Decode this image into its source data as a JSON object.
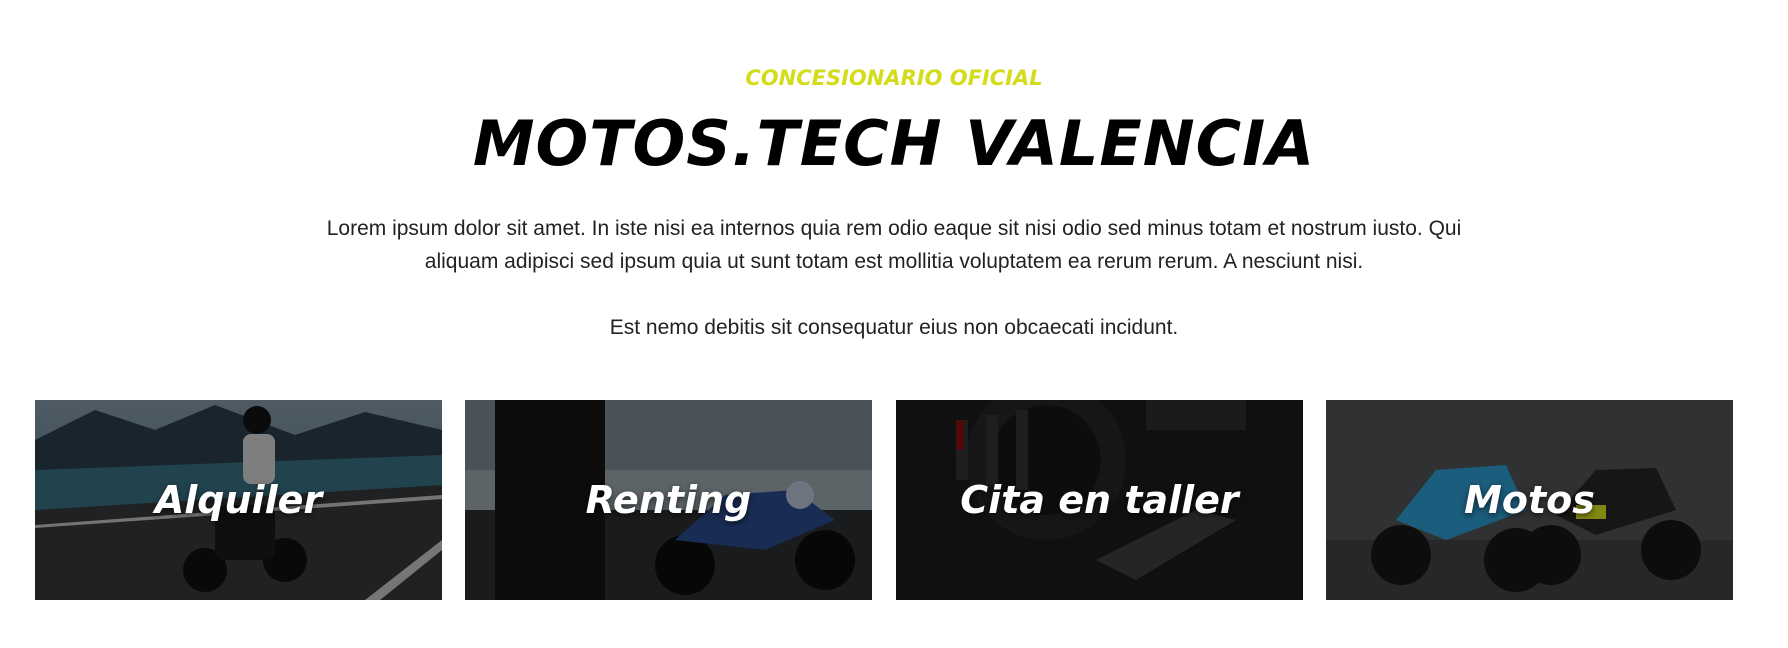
{
  "header": {
    "eyebrow": "CONCESIONARIO OFICIAL",
    "title": "MOTOS.TECH VALENCIA",
    "paragraph_1": "Lorem ipsum dolor sit amet. In iste nisi ea internos quia rem odio eaque sit nisi odio sed minus totam et nostrum iusto. Qui aliquam adipisci sed ipsum quia ut sunt totam est mollitia voluptatem ea rerum rerum. A nesciunt nisi.",
    "paragraph_2": "Est nemo debitis sit consequatur eius non obcaecati incidunt."
  },
  "colors": {
    "accent": "#d4dc1a",
    "title": "#000000",
    "body_text": "#222222",
    "card_overlay": "#000000"
  },
  "cards": [
    {
      "label": "Alquiler",
      "image": "rider-on-mountain-road-photo"
    },
    {
      "label": "Renting",
      "image": "rider-beside-blue-motorcycle-lake-photo"
    },
    {
      "label": "Cita en taller",
      "image": "motorcycle-engine-closeup-photo"
    },
    {
      "label": "Motos",
      "image": "two-naked-motorcycles-studio-photo"
    }
  ]
}
